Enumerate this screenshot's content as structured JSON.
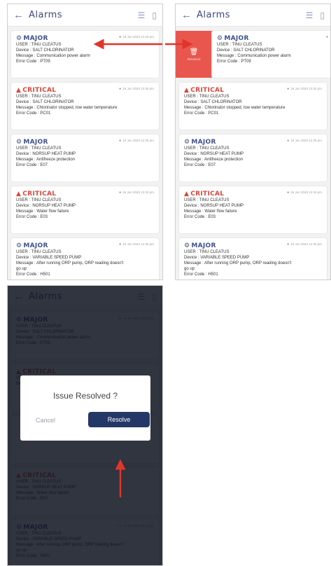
{
  "appbar": {
    "back_glyph": "←",
    "title": "Alarms",
    "filter_glyph": "☰",
    "book_glyph": "▯"
  },
  "alarms": [
    {
      "severity": "MAJOR",
      "icon": "⚙",
      "timestamp": "16 Jun 2020 12:29 pm",
      "user": "USER : TINU CLEATUS",
      "device": "Device : SALT CHLORINATOR",
      "message": "Message : Communication power alarm",
      "code": "Error Code : PT09"
    },
    {
      "severity": "CRITICAL",
      "icon": "▲",
      "timestamp": "16 Jun 2020 12:25 pm",
      "user": "USER : TINU CLEATUS",
      "device": "Device : SALT CHLORINATOR",
      "message": "Message : Chlorinator stopped, low water temperature",
      "code": "Error Code : PC01"
    },
    {
      "severity": "MAJOR",
      "icon": "⚙",
      "timestamp": "16 Jun 2020 12:29 pm",
      "user": "USER : TINU CLEATUS",
      "device": "Device : NORSUP HEAT PUMP",
      "message": "Message : Antifreeze protection",
      "code": "Error Code : E07"
    },
    {
      "severity": "CRITICAL",
      "icon": "▲",
      "timestamp": "16 Jun 2020 12:25 pm",
      "user": "USER : TINU CLEATUS",
      "device": "Device : NORSUP HEAT PUMP",
      "message": "Message : Water flow failure",
      "code": "Error Code : E03"
    },
    {
      "severity": "MAJOR",
      "icon": "⚙",
      "timestamp": "16 Jun 2020 12:30 pm",
      "user": "USER : TINU CLEATUS",
      "device": "Device : VARIABLE SPEED PUMP",
      "message": "Message : After running ORP pump, ORP reading doesn't",
      "message2": "go up",
      "code": "Error Code : H501"
    }
  ],
  "swipe": {
    "trash_glyph": "🗑",
    "label": "Resolved"
  },
  "dialog": {
    "title": "Issue Resolved ?",
    "cancel": "Cancel",
    "resolve": "Resolve"
  },
  "colors": {
    "major": "#3e4f8d",
    "critical": "#d9463b",
    "swipe": "#e9564d",
    "resolve_button": "#253766",
    "arrow": "#e0352d"
  }
}
